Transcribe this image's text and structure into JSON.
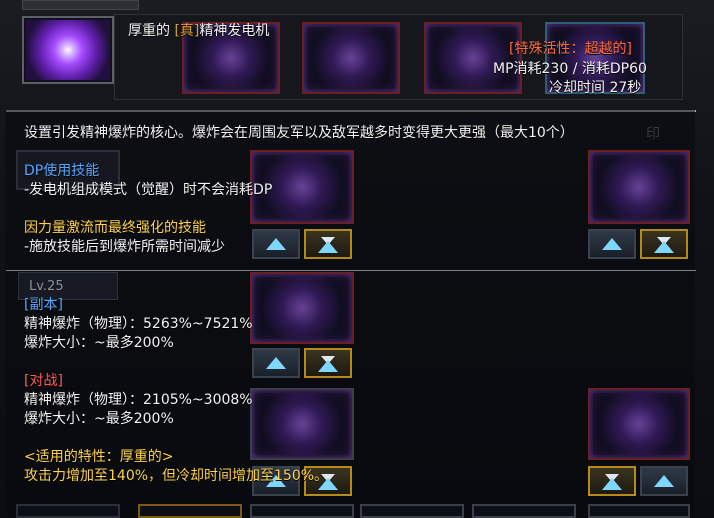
{
  "header": {
    "title_prefix": "厚重的",
    "title_bracket": "[真]",
    "title_suffix": "精神发电机",
    "special_label": "[特殊活性：超越的]",
    "cost": "MP消耗230 / 消耗DP60",
    "cooldown": "冷却时间 27秒"
  },
  "description": "设置引发精神爆炸的核心。爆炸会在周围友军以及敌军越多时变得更大更强（最大10个）",
  "dp_section": {
    "title": "DP使用技能",
    "line1": "-发电机组成模式（觉醒）时不会消耗DP",
    "subtitle": "因力量激流而最终强化的技能",
    "line2": "-施放技能后到爆炸所需时间减少"
  },
  "level_label": "Lv.25",
  "dungeon": {
    "tag": "[副本]",
    "stat1": "精神爆炸（物理）：5263%~7521%",
    "stat2": "爆炸大小：~最多200%"
  },
  "pvp": {
    "tag": "[对战]",
    "stat1": "精神爆炸（物理）：2105%~3008%",
    "stat2": "爆炸大小：~最多200%"
  },
  "trait": {
    "title": "<适用的特性：厚重的>",
    "line": "攻击力增加至140%，但冷却时间增加至150%。"
  },
  "faint_right_text": "印",
  "colors": {
    "blue": "#58a7ff",
    "yellow": "#ffd24a",
    "orange": "#ff6b3d",
    "red": "#ff5b5b"
  }
}
